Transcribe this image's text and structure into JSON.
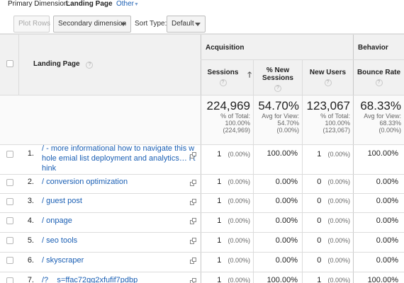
{
  "topbar": {
    "primary_dimension_label": "Primary Dimension:",
    "primary_dimension_value": "Landing Page",
    "other_label": "Other",
    "other_caret": "▼"
  },
  "toolbar": {
    "plot_rows": "Plot Rows",
    "secondary_dimension": "Secondary dimension",
    "sort_type_label": "Sort Type:",
    "sort_type_value": "Default"
  },
  "table": {
    "groups": {
      "acquisition": "Acquisition",
      "behavior": "Behavior"
    },
    "columns": {
      "landing_page": "Landing Page",
      "sessions": "Sessions",
      "new_sessions_line1": "% New",
      "new_sessions_line2": "Sessions",
      "new_users": "New Users",
      "bounce_rate": "Bounce Rate"
    },
    "help_icon": "?",
    "sort_arrow": "🡑",
    "totals": {
      "sessions": {
        "value": "224,969",
        "l1": "% of Total:",
        "l2": "100.00%",
        "l3": "(224,969)"
      },
      "new_sessions": {
        "value": "54.70%",
        "l1": "Avg for View:",
        "l2": "54.70%",
        "l3": "(0.00%)"
      },
      "new_users": {
        "value": "123,067",
        "l1": "% of Total:",
        "l2": "100.00%",
        "l3": "(123,067)"
      },
      "bounce_rate": {
        "value": "68.33%",
        "l1": "Avg for View:",
        "l2": "68.33%",
        "l3": "(0.00%)"
      }
    },
    "rows": [
      {
        "num": "1.",
        "page_l1": "/ - more informational how to navigate this w",
        "page_l2": "hole emial list deployment and analytics… i t",
        "page_l3": "hink",
        "sessions": "1",
        "sessions_pct": "(0.00%)",
        "new_sessions": "100.00%",
        "new_users": "1",
        "new_users_pct": "(0.00%)",
        "bounce": "100.00%"
      },
      {
        "num": "2.",
        "page_l1": "/ conversion optimization",
        "sessions": "1",
        "sessions_pct": "(0.00%)",
        "new_sessions": "0.00%",
        "new_users": "0",
        "new_users_pct": "(0.00%)",
        "bounce": "0.00%"
      },
      {
        "num": "3.",
        "page_l1": "/ guest post",
        "sessions": "1",
        "sessions_pct": "(0.00%)",
        "new_sessions": "0.00%",
        "new_users": "0",
        "new_users_pct": "(0.00%)",
        "bounce": "0.00%"
      },
      {
        "num": "4.",
        "page_l1": "/ onpage",
        "sessions": "1",
        "sessions_pct": "(0.00%)",
        "new_sessions": "0.00%",
        "new_users": "0",
        "new_users_pct": "(0.00%)",
        "bounce": "0.00%"
      },
      {
        "num": "5.",
        "page_l1": "/ seo tools",
        "sessions": "1",
        "sessions_pct": "(0.00%)",
        "new_sessions": "0.00%",
        "new_users": "0",
        "new_users_pct": "(0.00%)",
        "bounce": "0.00%"
      },
      {
        "num": "6.",
        "page_l1": "/ skyscraper",
        "sessions": "1",
        "sessions_pct": "(0.00%)",
        "new_sessions": "0.00%",
        "new_users": "0",
        "new_users_pct": "(0.00%)",
        "bounce": "0.00%"
      },
      {
        "num": "7.",
        "page_l1": "/?__s=ffac72gg2xfufif7pdbp",
        "sessions": "1",
        "sessions_pct": "(0.00%)",
        "new_sessions": "100.00%",
        "new_users": "1",
        "new_users_pct": "(0.00%)",
        "bounce": "100.00%"
      }
    ]
  },
  "colors": {
    "link": "#1a5fb4",
    "header_bg": "#f1f1f1",
    "border": "#dcdcdc"
  }
}
